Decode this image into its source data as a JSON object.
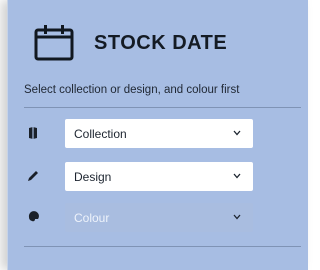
{
  "header": {
    "title": "STOCK DATE",
    "icon": "calendar-icon"
  },
  "instructions": "Select collection or design, and colour first",
  "selects": [
    {
      "icon": "book-icon",
      "value": "Collection",
      "enabled": true
    },
    {
      "icon": "pencil-icon",
      "value": "Design",
      "enabled": true
    },
    {
      "icon": "paint-drop-icon",
      "value": "Colour",
      "enabled": false
    }
  ],
  "colors": {
    "panel": "#a7bde3",
    "text": "#1d2530",
    "field": "#ffffff",
    "disabled_field": "#a9bde0"
  }
}
